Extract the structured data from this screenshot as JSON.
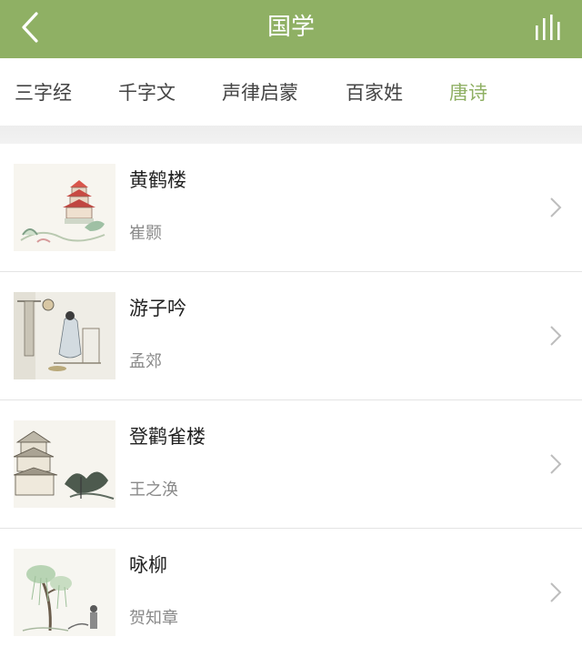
{
  "header": {
    "title": "国学",
    "back_icon": "chevron-left-icon",
    "stats_icon": "bar-chart-icon",
    "background": "#8fb064"
  },
  "tabs": [
    {
      "label": "三字经",
      "active": false
    },
    {
      "label": "千字文",
      "active": false
    },
    {
      "label": "声律启蒙",
      "active": false
    },
    {
      "label": "百家姓",
      "active": false
    },
    {
      "label": "唐诗",
      "active": true
    }
  ],
  "accent_color": "#8fb064",
  "poems": [
    {
      "title": "黄鹤楼",
      "author": "崔颢",
      "image": "pagoda-landscape-painting"
    },
    {
      "title": "游子吟",
      "author": "孟郊",
      "image": "mother-sewing-painting"
    },
    {
      "title": "登鹳雀楼",
      "author": "王之涣",
      "image": "tower-pine-painting"
    },
    {
      "title": "咏柳",
      "author": "贺知章",
      "image": "willow-tree-painting"
    }
  ]
}
